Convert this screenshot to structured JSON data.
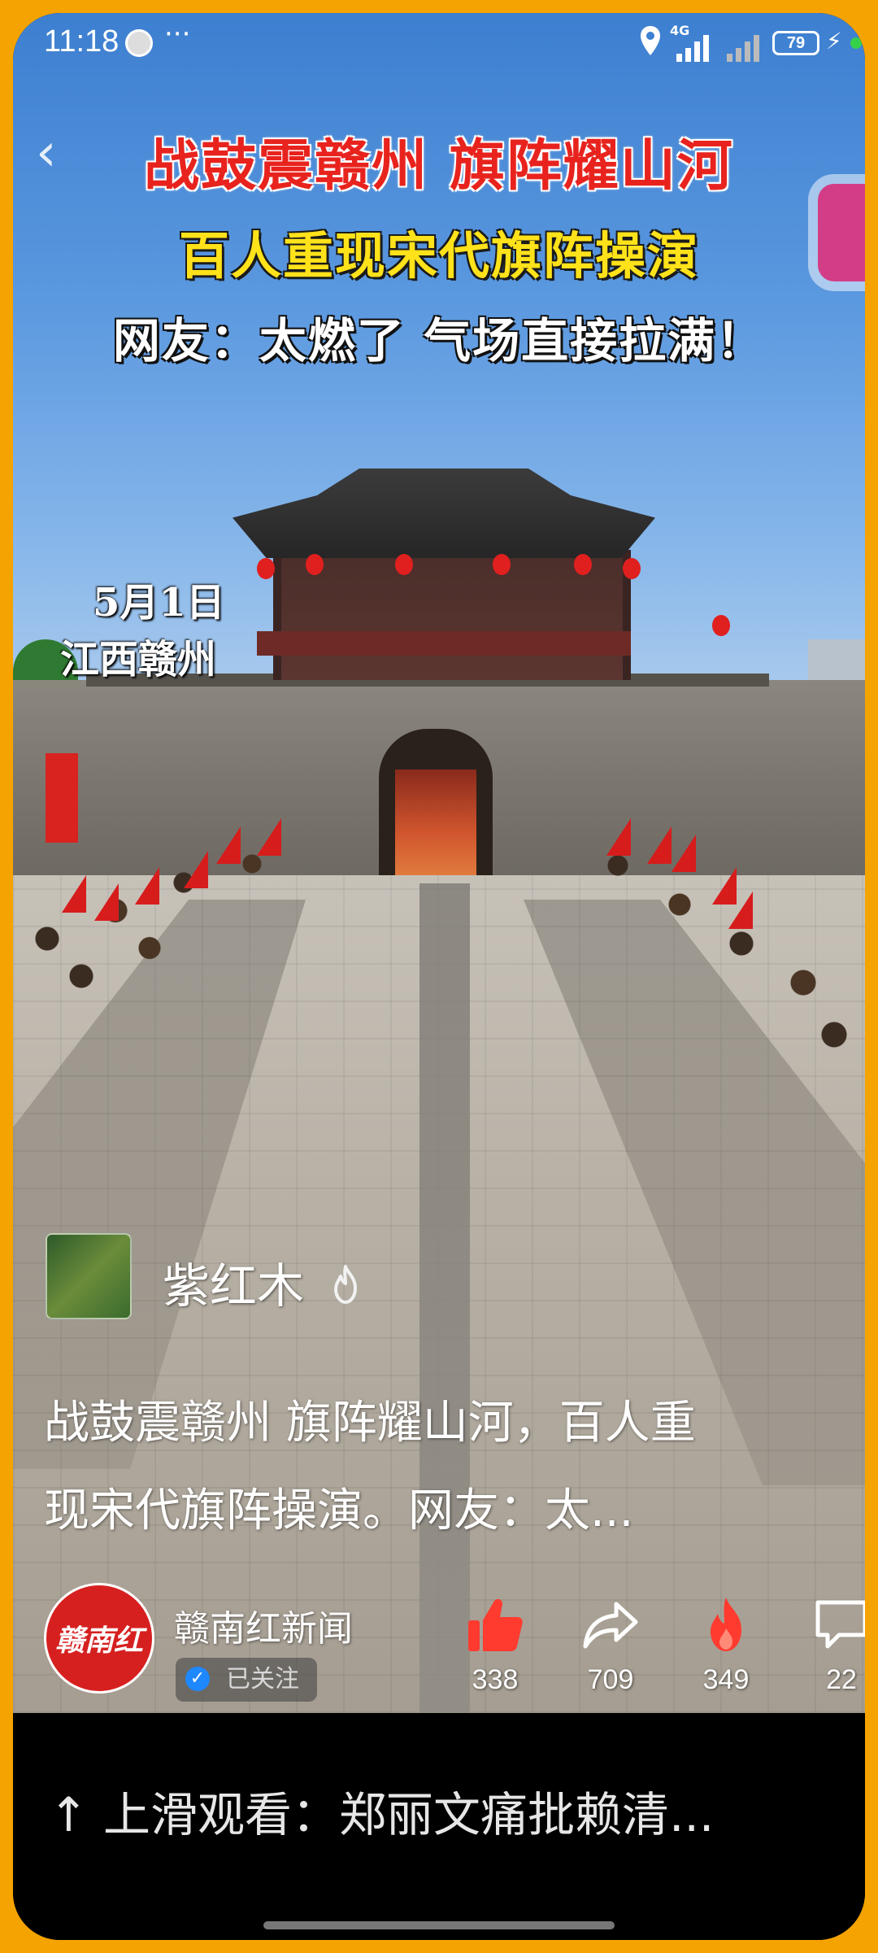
{
  "status_bar": {
    "time": "11:18",
    "more_glyph": "···",
    "network_label": "4G",
    "battery_level": "79"
  },
  "video": {
    "headline_line1": "战鼓震赣州  旗阵耀山河",
    "headline_line2": "百人重现宋代旗阵操演",
    "headline_line3": "网友：太燃了  气场直接拉满！",
    "caption_date": "5月1日",
    "caption_place": "江西赣州"
  },
  "author": {
    "name": "紫红木"
  },
  "description": {
    "line1": "战鼓震赣州  旗阵耀山河，百人重",
    "line2": "现宋代旗阵操演。网友：太..."
  },
  "publisher": {
    "name": "赣南红新闻",
    "avatar_text": "赣南红",
    "follow_status": "已关注"
  },
  "actions": {
    "like_count": "338",
    "share_count": "709",
    "fire_count": "349",
    "comment_count": "22"
  },
  "bottom": {
    "swipe_prompt": "↑ 上滑观看：郑丽文痛批赖清..."
  },
  "colors": {
    "frame": "#f5a300",
    "headline_red": "#e8231e",
    "headline_yellow": "#ffe21a",
    "like_red": "#ff3b30",
    "verified_blue": "#1e88ff"
  }
}
